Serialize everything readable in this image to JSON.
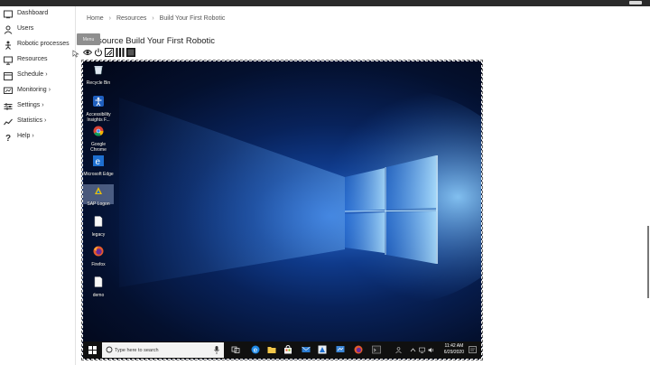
{
  "sidebar": {
    "items": [
      {
        "label": "Dashboard",
        "icon": "dashboard-icon"
      },
      {
        "label": "Users",
        "icon": "users-icon"
      },
      {
        "label": "Robotic processes",
        "icon": "robot-icon"
      },
      {
        "label": "Resources",
        "icon": "monitor-icon"
      },
      {
        "label": "Schedule",
        "icon": "calendar-icon",
        "chevron": "›"
      },
      {
        "label": "Monitoring",
        "icon": "monitoring-icon",
        "chevron": "›"
      },
      {
        "label": "Settings",
        "icon": "sliders-icon",
        "chevron": "›"
      },
      {
        "label": "Statistics",
        "icon": "chart-icon",
        "chevron": "›"
      },
      {
        "label": "Help",
        "icon": "help-icon",
        "chevron": "›"
      }
    ]
  },
  "breadcrumb": {
    "home": "Home",
    "sep": "›",
    "resources": "Resources",
    "current": "Build Your First Robotic"
  },
  "page": {
    "title": "Resource Build Your First Robotic",
    "tooltip": "Menu"
  },
  "toolbar": [
    "view-eye-icon",
    "power-icon",
    "screenshot-icon",
    "bars-icon",
    "stop-icon"
  ],
  "desktop": {
    "icons": [
      {
        "label": "Recycle Bin",
        "icon": "recycle-bin-icon"
      },
      {
        "label": "Accessibility Insights F...",
        "icon": "accessibility-icon"
      },
      {
        "label": "Google Chrome",
        "icon": "chrome-icon"
      },
      {
        "label": "Microsoft Edge",
        "icon": "edge-icon"
      },
      {
        "label": "SAP Logon",
        "icon": "sap-icon"
      },
      {
        "label": "legacy",
        "icon": "file-icon"
      },
      {
        "label": "Firefox",
        "icon": "firefox-icon"
      },
      {
        "label": "demo",
        "icon": "file-icon"
      }
    ],
    "taskbar": {
      "search_placeholder": "Type here to search",
      "time": "11:42 AM",
      "date": "6/29/2020"
    }
  },
  "colors": {
    "accent": "#0a64c8",
    "sidebar_text": "#2a2a2a"
  }
}
